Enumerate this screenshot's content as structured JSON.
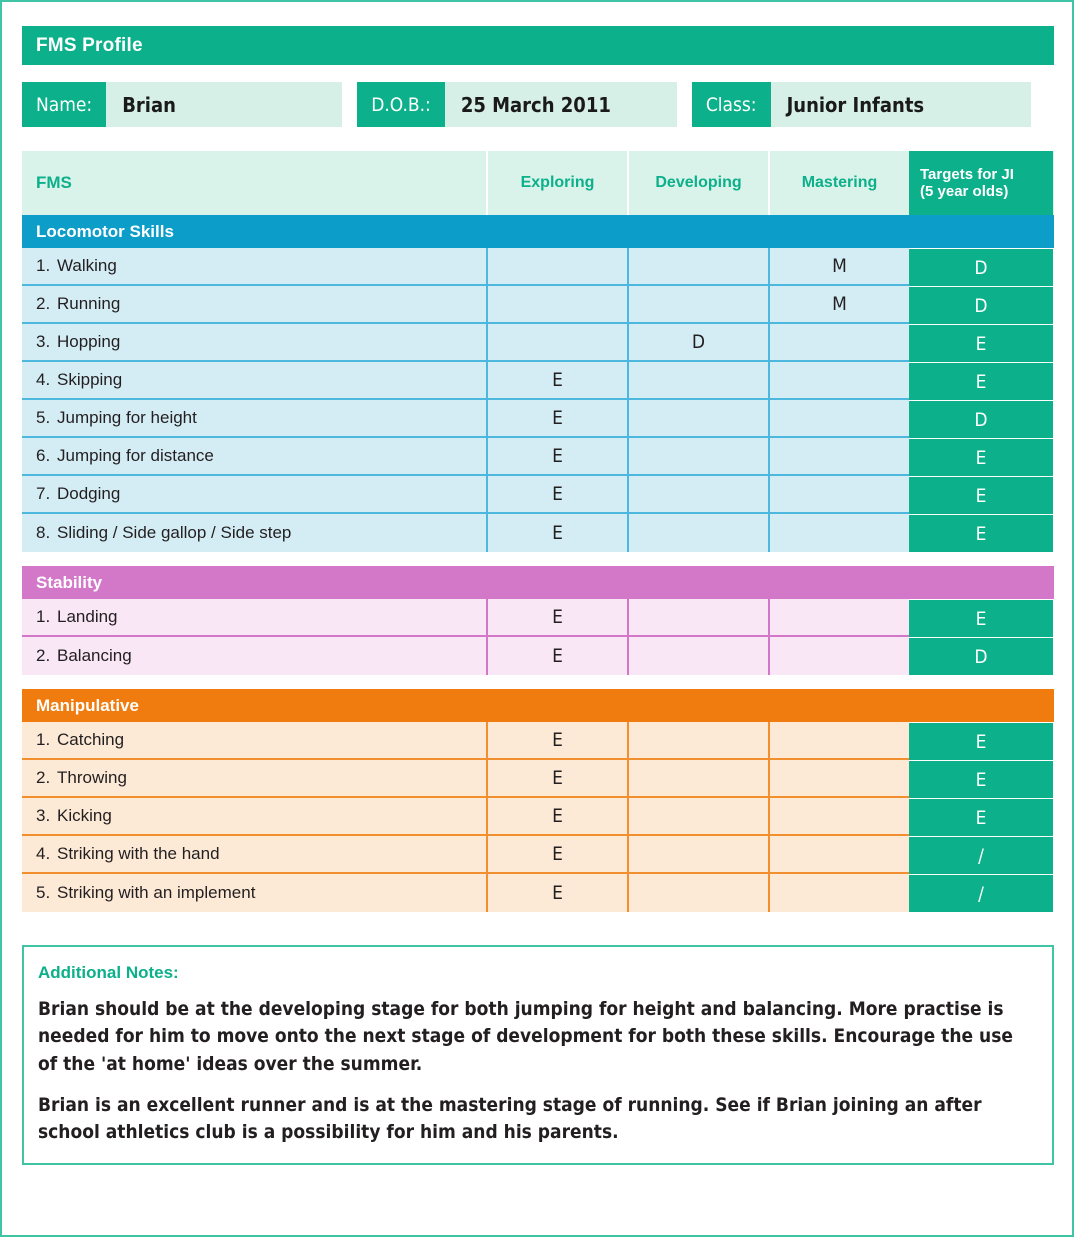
{
  "header": {
    "title": "FMS Profile",
    "fields": [
      {
        "label": "Name:",
        "value": "Brian"
      },
      {
        "label": "D.O.B.:",
        "value": "25 March 2011"
      },
      {
        "label": "Class:",
        "value": "Junior Infants"
      }
    ]
  },
  "table": {
    "columns": {
      "skill": "FMS",
      "exploring": "Exploring",
      "developing": "Developing",
      "mastering": "Mastering",
      "target_line1": "Targets for JI",
      "target_line2": "(5 year olds)"
    },
    "sections": [
      {
        "name": "Locomotor Skills",
        "color": "#0d9dc9",
        "rows": [
          {
            "num": "1.",
            "label": "Walking",
            "exploring": "",
            "developing": "",
            "mastering": "M",
            "target": "D"
          },
          {
            "num": "2.",
            "label": "Running",
            "exploring": "",
            "developing": "",
            "mastering": "M",
            "target": "D"
          },
          {
            "num": "3.",
            "label": "Hopping",
            "exploring": "",
            "developing": "D",
            "mastering": "",
            "target": "E"
          },
          {
            "num": "4.",
            "label": "Skipping",
            "exploring": "E",
            "developing": "",
            "mastering": "",
            "target": "E"
          },
          {
            "num": "5.",
            "label": "Jumping for height",
            "exploring": "E",
            "developing": "",
            "mastering": "",
            "target": "D"
          },
          {
            "num": "6.",
            "label": "Jumping for distance",
            "exploring": "E",
            "developing": "",
            "mastering": "",
            "target": "E"
          },
          {
            "num": "7.",
            "label": "Dodging",
            "exploring": "E",
            "developing": "",
            "mastering": "",
            "target": "E"
          },
          {
            "num": "8.",
            "label": "Sliding / Side gallop / Side step",
            "exploring": "E",
            "developing": "",
            "mastering": "",
            "target": "E"
          }
        ]
      },
      {
        "name": "Stability",
        "color": "#d377c8",
        "rows": [
          {
            "num": "1.",
            "label": "Landing",
            "exploring": "E",
            "developing": "",
            "mastering": "",
            "target": "E"
          },
          {
            "num": "2.",
            "label": "Balancing",
            "exploring": "E",
            "developing": "",
            "mastering": "",
            "target": "D"
          }
        ]
      },
      {
        "name": "Manipulative",
        "color": "#f07c10",
        "rows": [
          {
            "num": "1.",
            "label": "Catching",
            "exploring": "E",
            "developing": "",
            "mastering": "",
            "target": "E"
          },
          {
            "num": "2.",
            "label": "Throwing",
            "exploring": "E",
            "developing": "",
            "mastering": "",
            "target": "E"
          },
          {
            "num": "3.",
            "label": "Kicking",
            "exploring": "E",
            "developing": "",
            "mastering": "",
            "target": "E"
          },
          {
            "num": "4.",
            "label": "Striking with the hand",
            "exploring": "E",
            "developing": "",
            "mastering": "",
            "target": "/"
          },
          {
            "num": "5.",
            "label": "Striking with an implement",
            "exploring": "E",
            "developing": "",
            "mastering": "",
            "target": "/"
          }
        ]
      }
    ]
  },
  "notes": {
    "title": "Additional Notes:",
    "paragraphs": [
      "Brian should be at the developing stage for both jumping for height and balancing. More practise is needed for him to move onto the next stage of development for both these skills. Encourage the use of the 'at home' ideas over the summer.",
      "Brian is an excellent runner and is at the mastering stage of running. See if Brian joining an after school athletics club is a possibility for him and his parents."
    ]
  }
}
